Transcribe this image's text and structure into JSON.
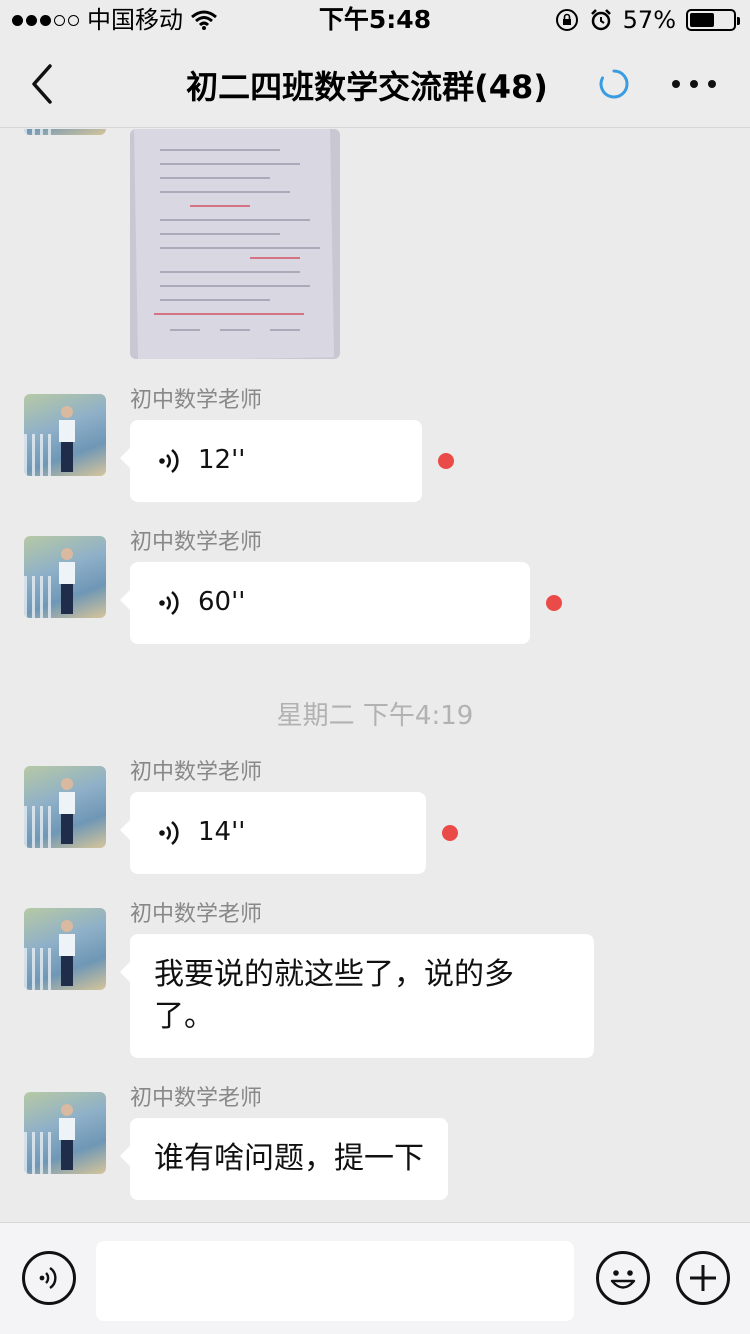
{
  "status_bar": {
    "carrier": "中国移动",
    "time": "下午5:48",
    "battery_percent": "57%",
    "battery_level": 0.57
  },
  "nav": {
    "title": "初二四班数学交流群(48)"
  },
  "messages": [
    {
      "sender": "初中数学老师",
      "type": "voice",
      "duration": "12''",
      "unread": true
    },
    {
      "sender": "初中数学老师",
      "type": "voice",
      "duration": "60''",
      "unread": true
    },
    {
      "sender": "初中数学老师",
      "type": "voice",
      "duration": "14''",
      "unread": true
    },
    {
      "sender": "初中数学老师",
      "type": "text",
      "text": "我要说的就这些了，说的多了。"
    },
    {
      "sender": "初中数学老师",
      "type": "text",
      "text": "谁有啥问题，提一下"
    }
  ],
  "time_separator": "星期二 下午4:19",
  "input": {
    "value": ""
  },
  "colors": {
    "background": "#ebebeb",
    "bubble": "#ffffff",
    "unread_dot": "#ea4b48",
    "spinner": "#3a9ce0"
  },
  "icons": [
    "back-arrow-icon",
    "loading-spinner-icon",
    "more-icon",
    "voice-icon",
    "emoji-icon",
    "add-icon",
    "wifi-icon",
    "lock-rotation-icon",
    "alarm-icon"
  ]
}
